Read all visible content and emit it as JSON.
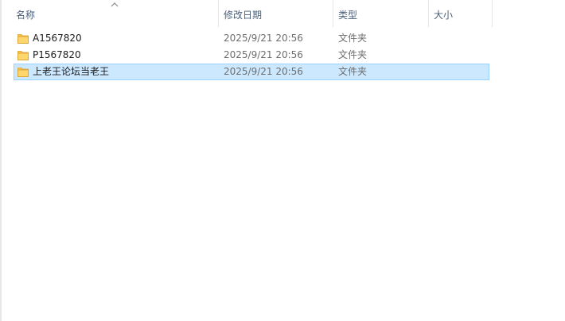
{
  "columns": {
    "name": "名称",
    "date_modified": "修改日期",
    "type": "类型",
    "size": "大小"
  },
  "sort": {
    "column": "name",
    "direction": "ascending",
    "icon": "sort-up-icon"
  },
  "files": [
    {
      "name": "A1567820",
      "date_modified": "2025/9/21 20:56",
      "type": "文件夹",
      "size": "",
      "icon": "folder-icon",
      "selected": false
    },
    {
      "name": "P1567820",
      "date_modified": "2025/9/21 20:56",
      "type": "文件夹",
      "size": "",
      "icon": "folder-icon",
      "selected": false
    },
    {
      "name": "上老王论坛当老王",
      "date_modified": "2025/9/21 20:56",
      "type": "文件夹",
      "size": "",
      "icon": "folder-icon",
      "selected": true
    }
  ],
  "colors": {
    "selection_fill": "#cce8ff",
    "selection_border": "#99d1ff",
    "folder_yellow": "#ffd26a",
    "header_text": "#4c607a"
  }
}
